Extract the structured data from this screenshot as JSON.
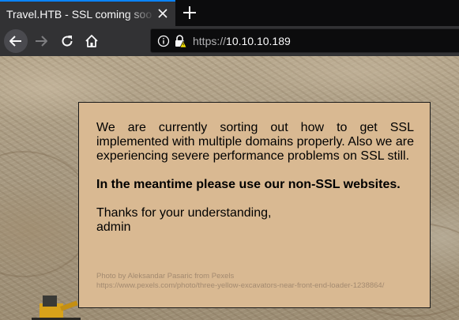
{
  "browser": {
    "tab": {
      "title": "Travel.HTB - SSL coming soon"
    },
    "toolbar": {
      "icons": [
        "back-arrow-icon",
        "forward-arrow-icon",
        "reload-icon",
        "home-icon"
      ]
    },
    "urlbar": {
      "scheme": "https://",
      "host": "10.10.10.189",
      "icons": [
        "info-icon",
        "insecure-lock-icon"
      ]
    }
  },
  "page": {
    "notice": {
      "paragraph1": "We are currently sorting out how to get SSL implemented with multiple domains properly. Also we are experiencing severe performance problems on SSL still.",
      "paragraph2": "In the meantime please use our non-SSL websites.",
      "thanks": "Thanks for your understanding,",
      "signature": "admin",
      "credit_line1": "Photo by Aleksandar Pasaric from Pexels",
      "credit_line2": "https://www.pexels.com/photo/three-yellow-excavators-near-front-end-loader-1238864/"
    }
  },
  "colors": {
    "accent": "#0a84ff",
    "notice_bg": "#d9b992",
    "toolbar_bg": "#323234"
  }
}
